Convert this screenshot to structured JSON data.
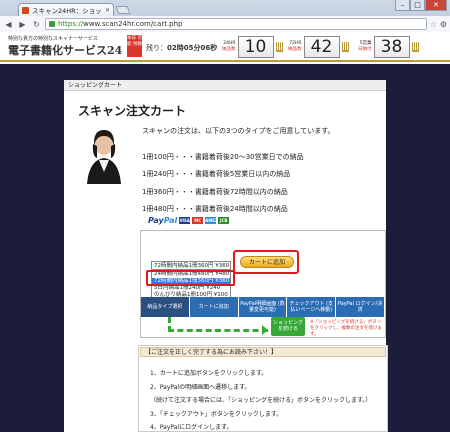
{
  "browser": {
    "tab_title": "スキャン24HR：ショッ…",
    "url_scheme": "https://",
    "url_rest": "www.scan24hr.com/cart.php"
  },
  "site": {
    "tagline": "特別な貴方の特別なスキャナーサービス",
    "name": "電子書籍化サービス24",
    "urgent_badge": "本日 可能 残数",
    "remaining_prefix": "残り：",
    "remaining_time": "02時05分06秒",
    "counters": [
      {
        "label_top": "24HR",
        "label_bottom": "納品数",
        "value": "10"
      },
      {
        "label_top": "72HR",
        "label_bottom": "納品数",
        "value": "42"
      },
      {
        "label_top": "5営業",
        "label_bottom": "日納付",
        "value": "38"
      }
    ]
  },
  "breadcrumb": "ショッピングカート",
  "page_title": "スキャン注文カート",
  "intro": "スキャンの注文は、以下の3つのタイプをご用意しています。",
  "rules": [
    "1冊100円・・・書籍着荷後20～30営業日での納品",
    "1冊240円・・・書籍着荷後5営業日以内の納品",
    "1冊360円・・・書籍着荷後72時間以内の納品",
    "1冊480円・・・書籍着荷後24時間以内の納品"
  ],
  "paypal": {
    "pay": "Pay",
    "pal": "Pal",
    "cards": [
      "VISA",
      "MC",
      "AMEX",
      "JCB"
    ]
  },
  "cart": {
    "select_value": "72時間内納品1冊360円 ¥360",
    "options": [
      "24時間内納品1冊480円 ¥480",
      "72時間内納品1冊360円 ¥360",
      "5日内納品1冊240円 ¥240",
      "のんびり納品1冊100円 ¥100"
    ],
    "add_button": "カートに追加"
  },
  "steps": [
    "納品タイプ選択",
    "カートに追加",
    "PayPal明細画面 (数量変更可能)",
    "チェックアウト (支払いページへ移動)",
    "PayPal ログイン/決済"
  ],
  "continue_button": "ショッピング を続ける",
  "continue_note": "※「ショッピングを続ける」ボタンをクリックし、複数の注文を続けます。",
  "notice_title": "【ご注文を正しく完了する為にお読み下さい！】",
  "instructions": [
    "1、カートに追加ボタンをクリックします。",
    "2、PayPalの明細画面へ遷移します。",
    "（続けて注文する場合には、「ショッピングを続ける」ボタンをクリックします。）",
    "3、「チェックアウト」ボタンをクリックします。",
    "4、PayPalにログインします。"
  ],
  "colors": {
    "accent": "#d9372a",
    "gold": "#b99a3c",
    "nav_blue": "#2b6cb3",
    "green": "#36a836",
    "page_bg": "#1c1d3a"
  }
}
